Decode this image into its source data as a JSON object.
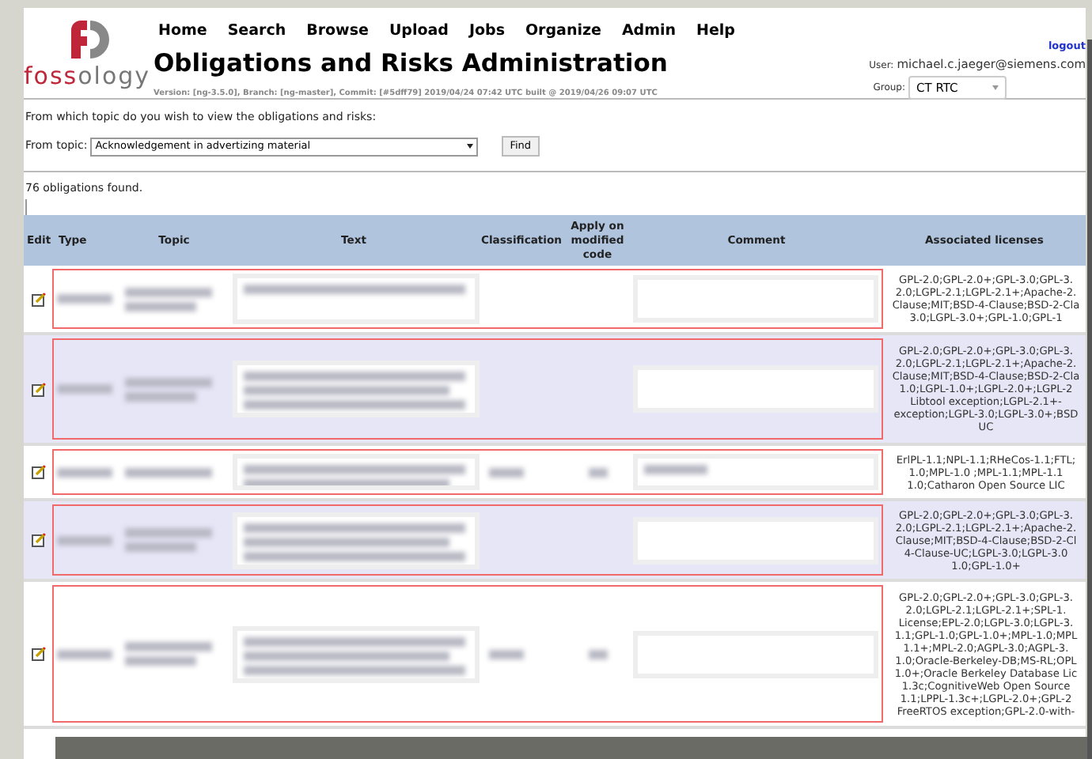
{
  "logo": {
    "first": "foss",
    "second": "ology"
  },
  "nav": [
    "Home",
    "Search",
    "Browse",
    "Upload",
    "Jobs",
    "Organize",
    "Admin",
    "Help"
  ],
  "title": "Obligations and Risks Administration",
  "version": "Version: [ng-3.5.0], Branch: [ng-master], Commit: [#5dff79] 2019/04/24 07:42 UTC built @ 2019/04/26 09:07 UTC",
  "user": {
    "logout": "logout",
    "label": "User:",
    "email": "michael.c.jaeger@siemens.com",
    "group_label": "Group:",
    "group": "CT RTC"
  },
  "prompt": "From which topic do you wish to view the obligations and risks:",
  "topic": {
    "label": "From topic:",
    "value": "Acknowledgement in advertizing material",
    "button": "Find"
  },
  "count": "76 obligations found.",
  "table": {
    "columns": [
      "Edit",
      "Type",
      "Topic",
      "Text",
      "Classification",
      "Apply on modified code",
      "Comment",
      "Associated licenses"
    ],
    "rows": [
      {
        "licenses": [
          "GPL-2.0;GPL-2.0+;GPL-3.0;GPL-3.",
          "2.0;LGPL-2.1;LGPL-2.1+;Apache-2.",
          "Clause;MIT;BSD-4-Clause;BSD-2-Cla",
          "3.0;LGPL-3.0+;GPL-1.0;GPL-1"
        ]
      },
      {
        "licenses": [
          "GPL-2.0;GPL-2.0+;GPL-3.0;GPL-3.",
          "2.0;LGPL-2.1;LGPL-2.1+;Apache-2.",
          "Clause;MIT;BSD-4-Clause;BSD-2-Cla",
          "1.0;LGPL-1.0+;LGPL-2.0+;LGPL-2",
          "Libtool exception;LGPL-2.1+-",
          "exception;LGPL-3.0;LGPL-3.0+;BSD",
          "UC"
        ]
      },
      {
        "licenses": [
          "ErlPL-1.1;NPL-1.1;RHeCos-1.1;FTL;",
          "1.0;MPL-1.0 ;MPL-1.1;MPL-1.1",
          "1.0;Catharon Open Source LIC"
        ]
      },
      {
        "licenses": [
          "GPL-2.0;GPL-2.0+;GPL-3.0;GPL-3.",
          "2.0;LGPL-2.1;LGPL-2.1+;Apache-2.",
          "Clause;MIT;BSD-4-Clause;BSD-2-Cl",
          "4-Clause-UC;LGPL-3.0;LGPL-3.0",
          "1.0;GPL-1.0+"
        ]
      },
      {
        "licenses": [
          "GPL-2.0;GPL-2.0+;GPL-3.0;GPL-3.",
          "2.0;LGPL-2.1;LGPL-2.1+;SPL-1.",
          "License;EPL-2.0;LGPL-3.0;LGPL-3.",
          "1.1;GPL-1.0;GPL-1.0+;MPL-1.0;MPL",
          "1.1+;MPL-2.0;AGPL-3.0;AGPL-3.",
          "1.0;Oracle-Berkeley-DB;MS-RL;OPL",
          "1.0+;Oracle Berkeley Database Lic",
          "1.3c;CognitiveWeb Open Source",
          "1.1;LPPL-1.3c+;LGPL-2.0+;GPL-2",
          "FreeRTOS exception;GPL-2.0-with-"
        ]
      }
    ]
  }
}
